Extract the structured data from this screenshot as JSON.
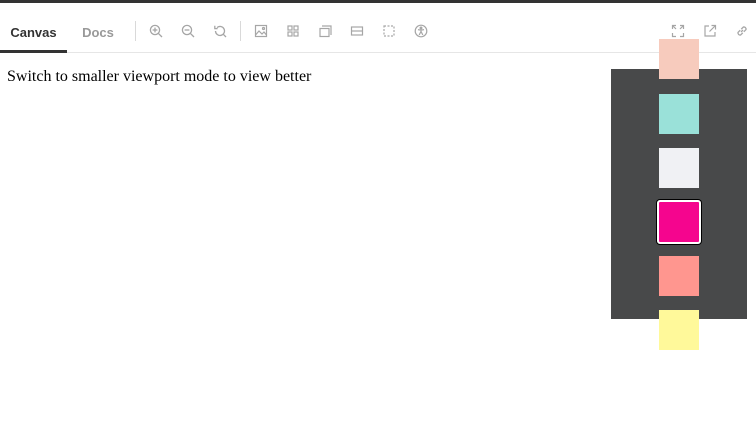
{
  "tabs": {
    "canvas": "Canvas",
    "docs": "Docs",
    "active": "Canvas"
  },
  "toolbar": {
    "left_icons": [
      "zoom-in-icon",
      "zoom-out-icon",
      "reset-zoom-icon",
      "background-icon",
      "grid-icon",
      "measure-icon",
      "outline-icon",
      "viewport-icon",
      "accessibility-icon"
    ],
    "right_icons": [
      "fullscreen-icon",
      "open-new-tab-icon",
      "copy-link-icon"
    ]
  },
  "message": "Switch to smaller viewport mode to view better",
  "colors": {
    "panel_bg": "#48494a",
    "accent_tab": "#333333",
    "icon_gray": "#a6a6a6"
  },
  "swatches": [
    {
      "color": "#f7cbbd",
      "selected": false
    },
    {
      "color": "#9ae1d9",
      "selected": false
    },
    {
      "color": "#f0f1f4",
      "selected": false
    },
    {
      "color": "#f5058e",
      "selected": true
    },
    {
      "color": "#ff968f",
      "selected": false
    },
    {
      "color": "#fff99a",
      "selected": false
    }
  ]
}
